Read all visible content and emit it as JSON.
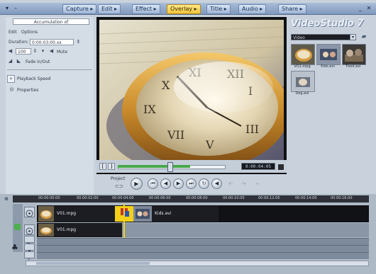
{
  "steps": [
    "Capture",
    "Edit",
    "Effect",
    "Overlay",
    "Title",
    "Audio",
    "Share"
  ],
  "active_step": "Overlay",
  "left_panel": {
    "header_field": "Accumulation of",
    "label_a": "Edit",
    "label_b": "Options",
    "duration_label": "Duration:",
    "duration_value": "0:00:03:00.xx",
    "volume_value": "100",
    "mute_label": "Mute",
    "checkbox_label": "Fade in/Out",
    "playback_button": "Playback Speed",
    "properties_label": "Properties"
  },
  "preview": {
    "timecode": "0:00:04:05"
  },
  "brand": "VideoStudio 7",
  "library": {
    "category": "Video",
    "items": [
      {
        "label": "VO1.mpg"
      },
      {
        "label": "Kids.avi"
      },
      {
        "label": "Food.avi"
      },
      {
        "label": "Dog.avi"
      }
    ]
  },
  "navigation": {
    "mode_label": "Project",
    "buttons": [
      "play",
      "home",
      "previous",
      "next",
      "end",
      "repeat",
      "volume"
    ]
  },
  "timeline": {
    "ruler_ticks": [
      "00:00:00:00",
      "00:00:02:00",
      "00:00:04:00",
      "00:00:06:00",
      "00:00:08:00",
      "00:00:10:00",
      "00:00:12:00",
      "00:00:14:00",
      "00:00:16:00",
      "00:00:18:00"
    ],
    "video_clips": [
      {
        "label": "V01.mpg"
      },
      {
        "label": "Kids.avi"
      }
    ],
    "overlay_clips": [
      {
        "label": "V01.mpg"
      }
    ]
  }
}
